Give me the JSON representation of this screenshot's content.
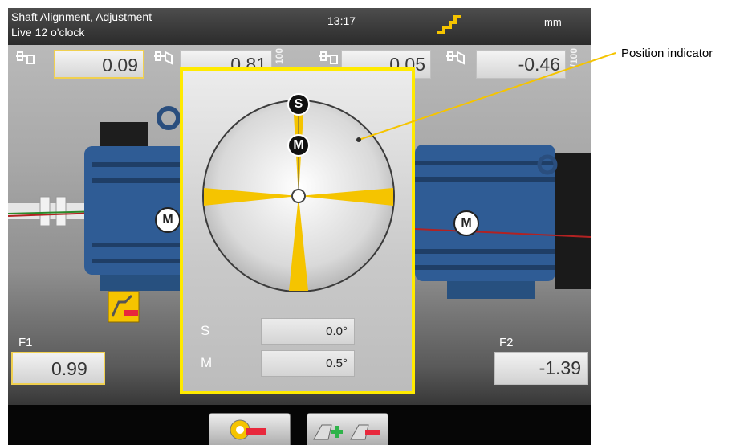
{
  "header": {
    "title": "Shaft Alignment, Adjustment",
    "subtitle": "Live 12 o'clock",
    "clock": "13:17",
    "units": "mm"
  },
  "readings": {
    "vertical_offset": "0.09",
    "vertical_angularity": "0.81",
    "horizontal_offset": "0.05",
    "horizontal_angularity": "-0.46",
    "scale_left": "100",
    "scale_right": "/100"
  },
  "machines": {
    "stationary_label": "M",
    "movable_label": "M"
  },
  "inclinometer": {
    "sensor_marker": "S",
    "machine_marker": "M",
    "s_label": "S",
    "s_value": "0.0°",
    "m_label": "M",
    "m_value": "0.5°"
  },
  "feet": {
    "f1_label": "F1",
    "f1_value": "0.99",
    "f2_label": "F2",
    "f2_value": "-1.39"
  },
  "annotation": {
    "label": "Position indicator"
  },
  "colors": {
    "highlight": "#ffea00",
    "accent": "#f5c400",
    "minus": "#e8283c",
    "plus": "#2fb34a"
  }
}
